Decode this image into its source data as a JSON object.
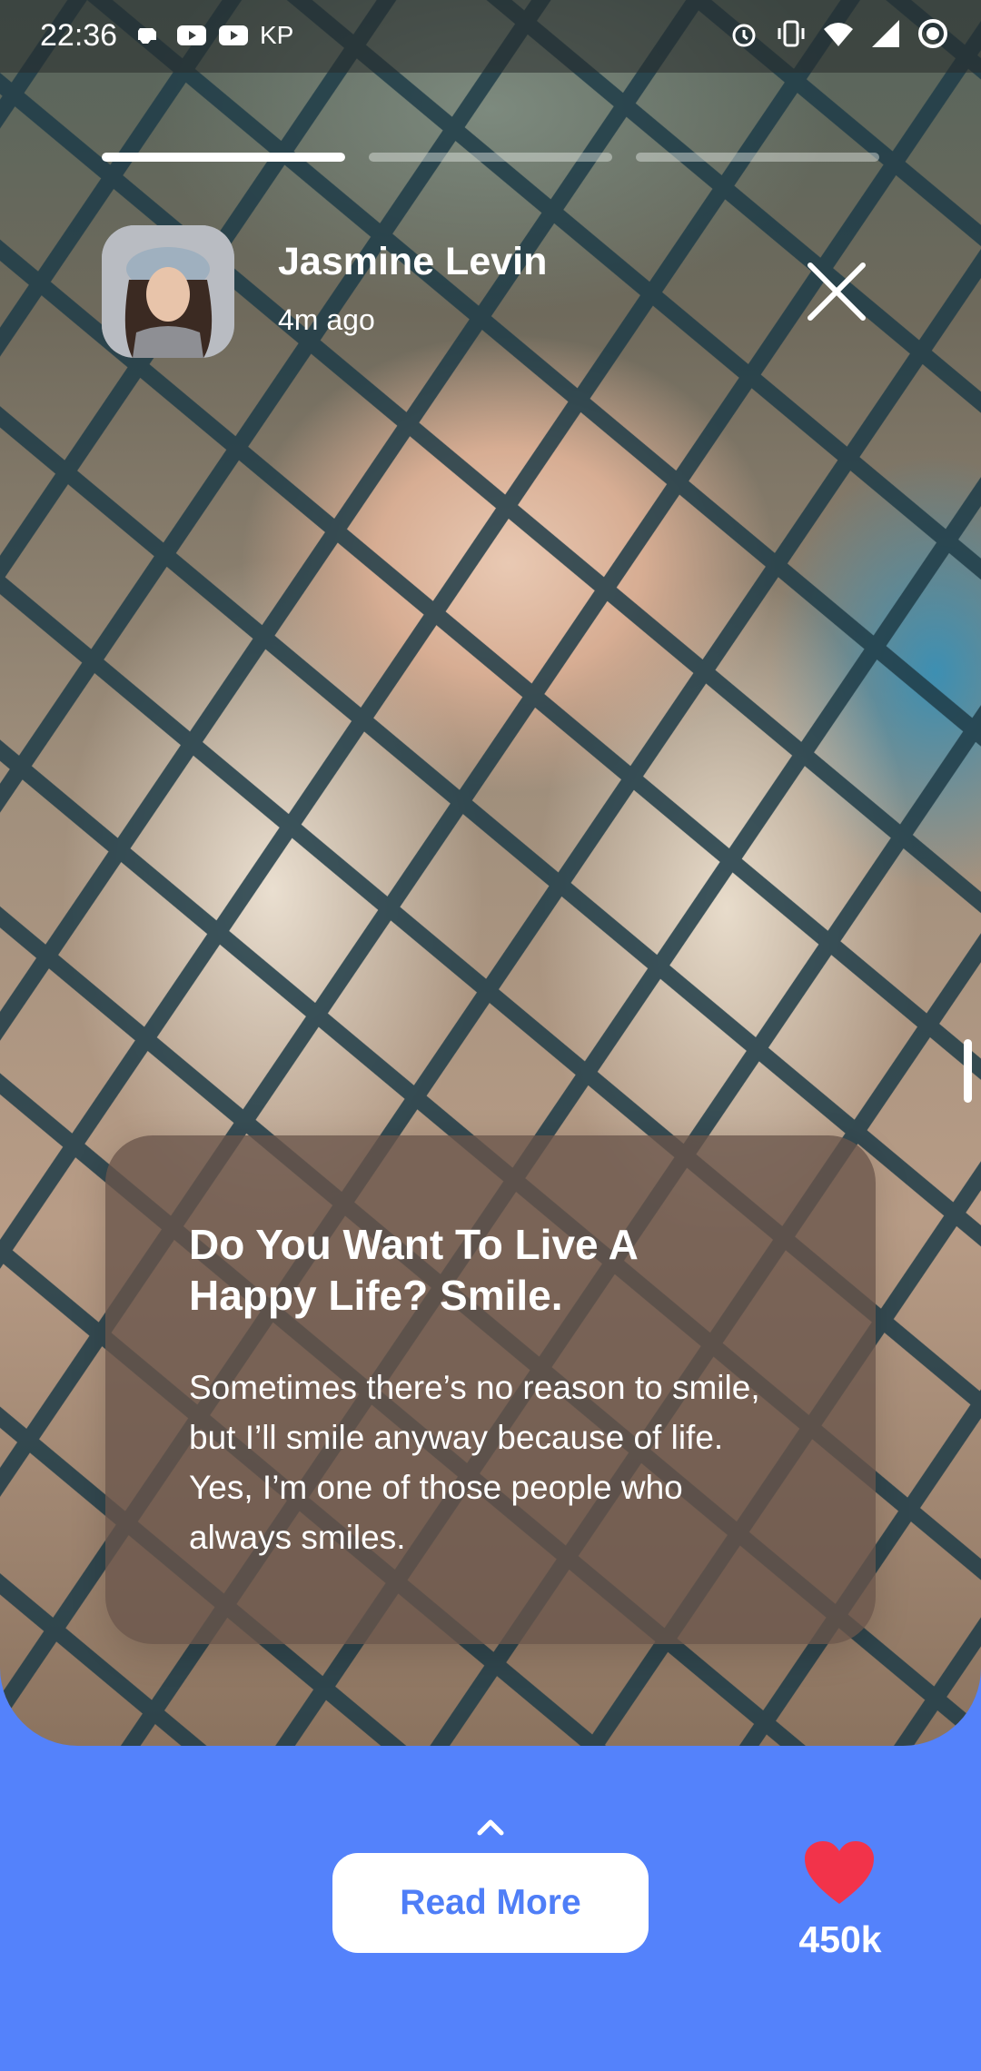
{
  "status_bar": {
    "time": "22:36",
    "carrier_label": "KP",
    "left_icons": [
      "game-controller-icon",
      "youtube-icon",
      "youtube-icon"
    ],
    "right_icons": [
      "alarm-icon",
      "vibrate-icon",
      "wifi-icon",
      "cell-signal-icon",
      "record-icon"
    ]
  },
  "story": {
    "progress": [
      1.0,
      0.0,
      0.0
    ],
    "user": {
      "name": "Jasmine Levin",
      "time_ago": "4m ago"
    },
    "card": {
      "title": "Do You Want To Live A Happy Life? Smile.",
      "body": "Sometimes there’s no reason to smile, but I’ll smile anyway because of life. Yes, I’m one of those people who always smiles."
    }
  },
  "footer": {
    "read_more_label": "Read More",
    "likes_count": "450k"
  },
  "colors": {
    "accent_blue": "#5482fb",
    "read_more_text": "#4f7ef7",
    "heart": "#f2334a",
    "card_bg": "#6a554a"
  }
}
